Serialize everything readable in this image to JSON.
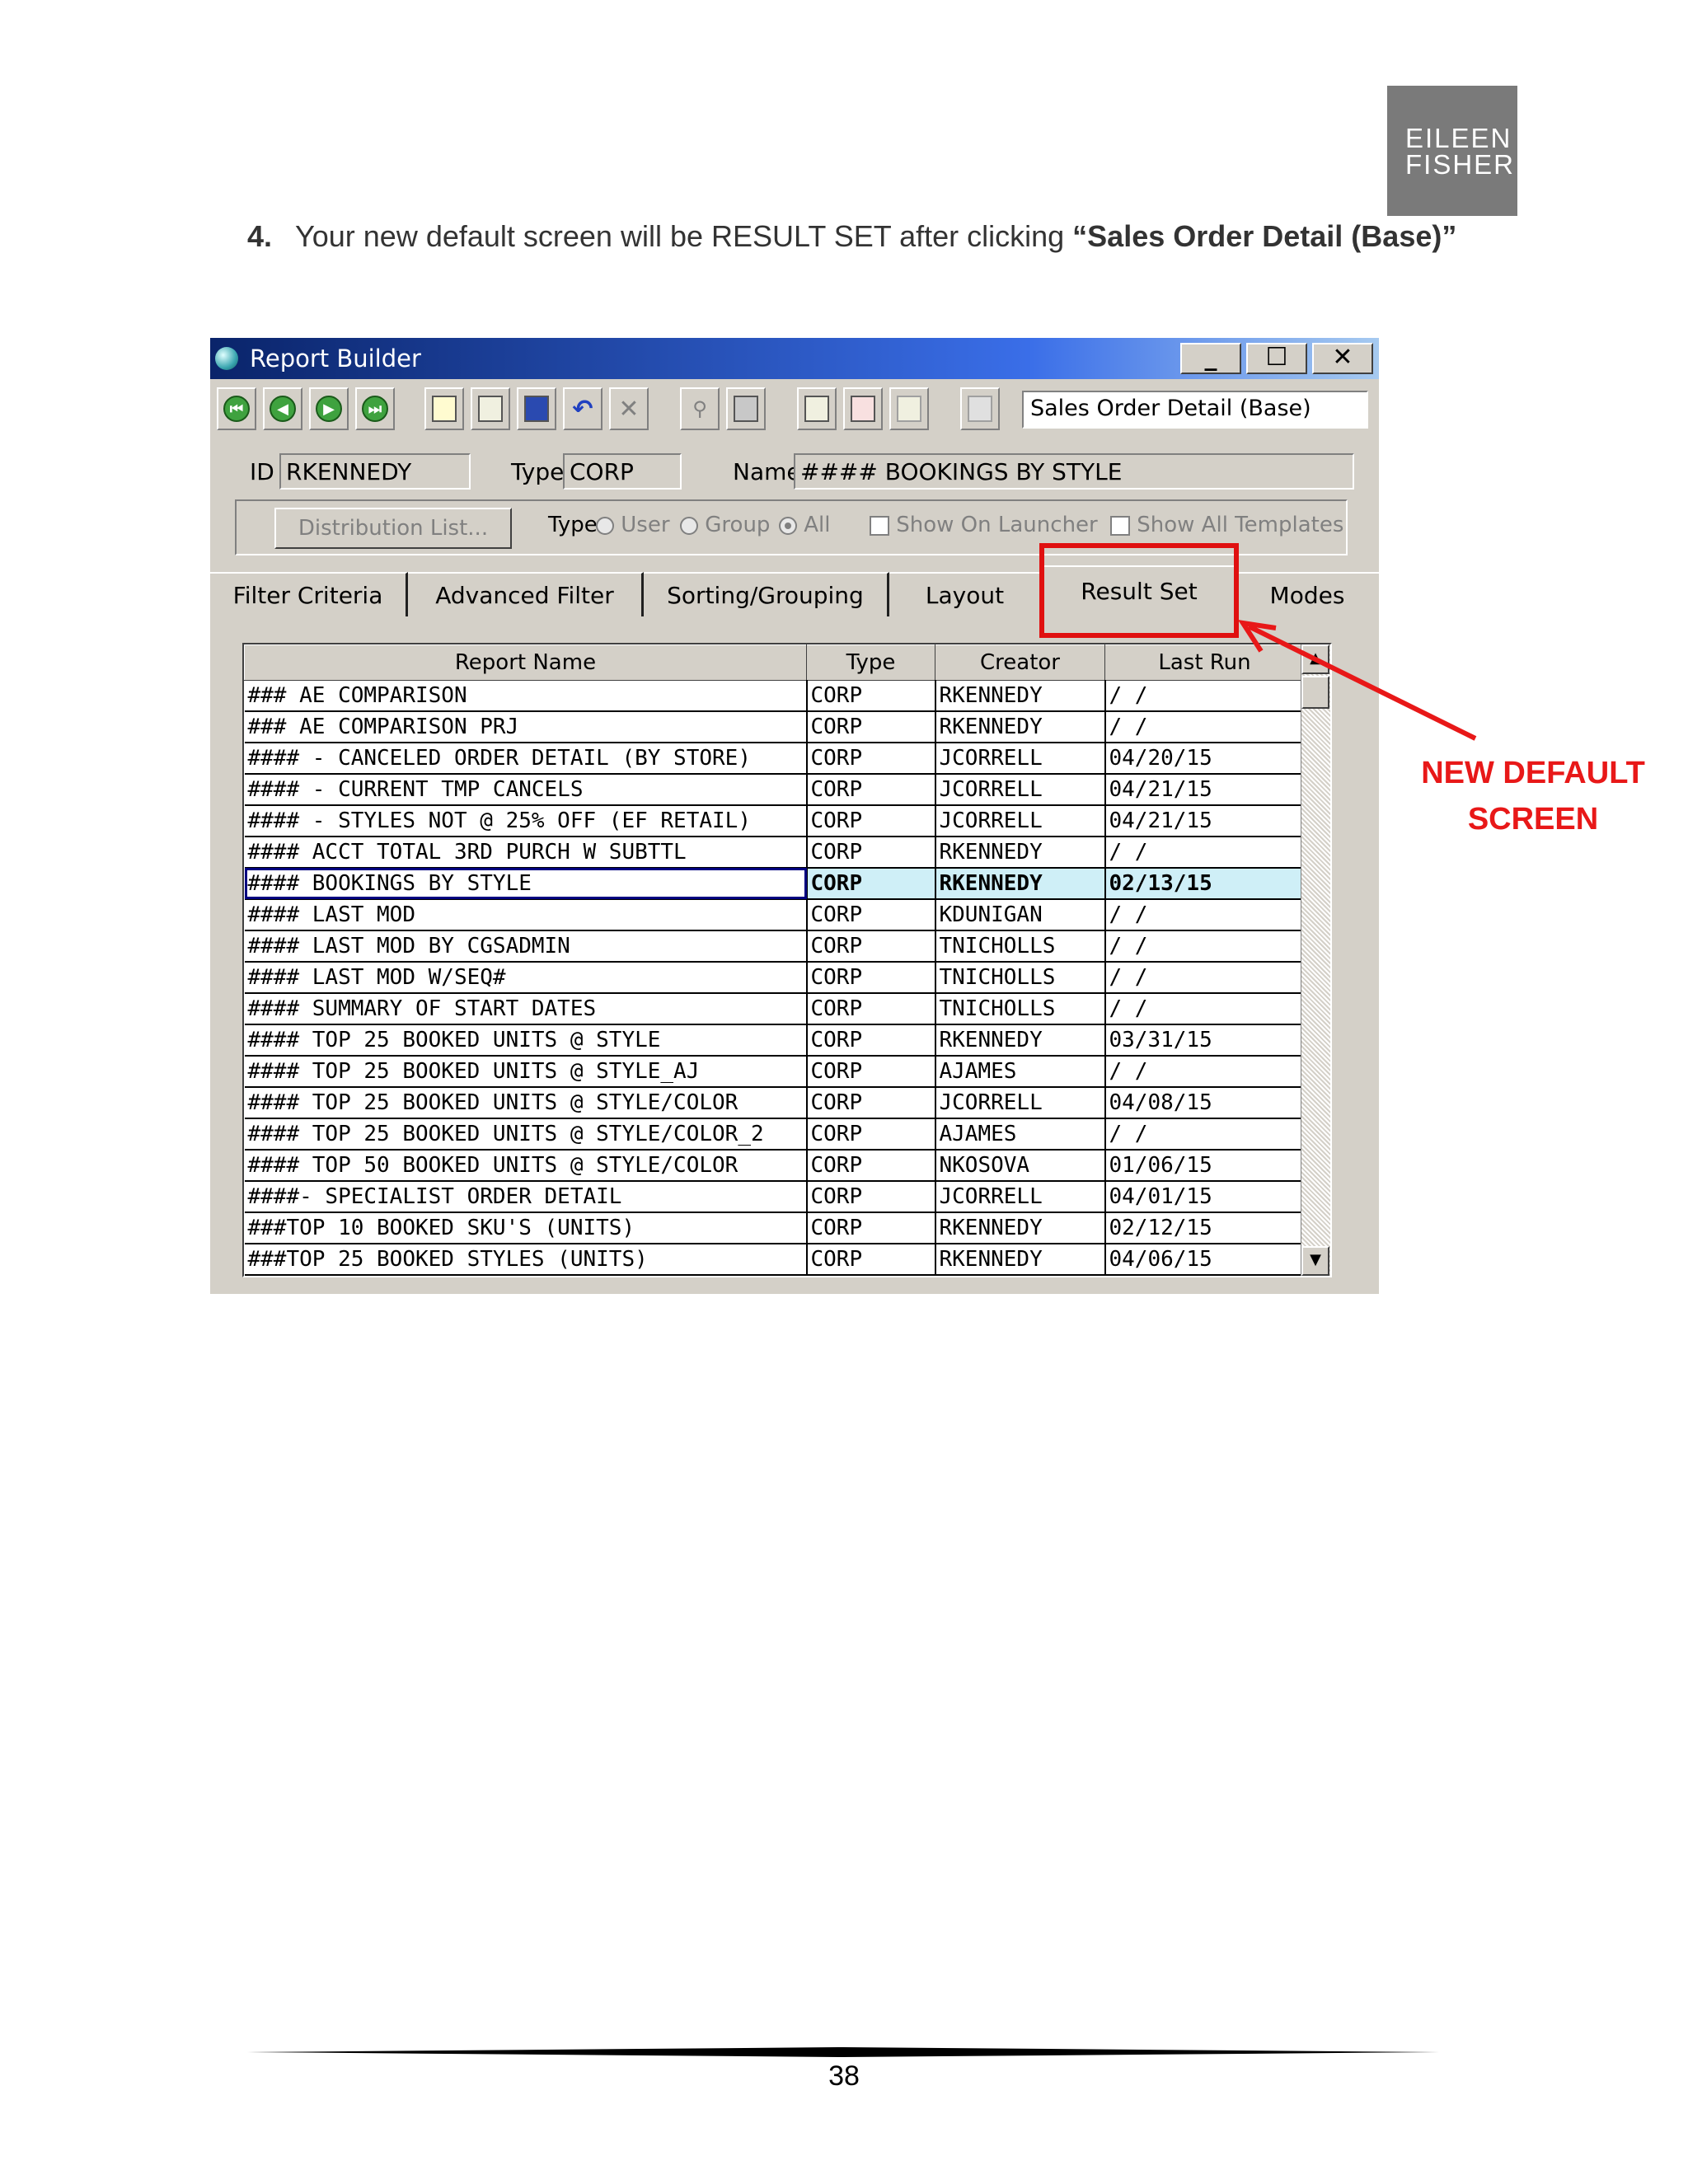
{
  "logo": {
    "line1": "EILEEN",
    "line2": "FISHER"
  },
  "instruction": {
    "number": "4.",
    "text": "Your new default screen will be RESULT SET after clicking ",
    "emphasis": "“Sales Order Detail (Base)”"
  },
  "window": {
    "title": "Report Builder",
    "caption_buttons": {
      "minimize": "_",
      "maximize": "☐",
      "close": "✕"
    },
    "report_select_value": "Sales Order Detail (Base)",
    "id_label": "ID",
    "id_value": "RKENNEDY",
    "type_label": "Type",
    "type_value": "CORP",
    "name_label": "Name",
    "name_value": "#### BOOKINGS BY STYLE",
    "distribution_button": "Distribution List...",
    "type_filter_label": "Type",
    "radio_user": "User",
    "radio_group": "Group",
    "radio_all": "All",
    "radio_selected": "All",
    "show_on_launcher": "Show On Launcher",
    "show_all_templates": "Show All Templates"
  },
  "tabs": [
    {
      "label": "Filter Criteria",
      "active": false
    },
    {
      "label": "Advanced Filter",
      "active": false
    },
    {
      "label": "Sorting/Grouping",
      "active": false
    },
    {
      "label": "Layout",
      "active": false
    },
    {
      "label": "Result Set",
      "active": true
    },
    {
      "label": "Modes",
      "active": false
    }
  ],
  "grid": {
    "columns": [
      "Report Name",
      "Type",
      "Creator",
      "Last Run"
    ],
    "selected_row": 6,
    "rows": [
      [
        "### AE COMPARISON",
        "CORP",
        "RKENNEDY",
        "/ /"
      ],
      [
        "### AE COMPARISON PRJ",
        "CORP",
        "RKENNEDY",
        "/ /"
      ],
      [
        "#### - CANCELED ORDER DETAIL (BY STORE)",
        "CORP",
        "JCORRELL",
        "04/20/15"
      ],
      [
        "#### - CURRENT TMP CANCELS",
        "CORP",
        "JCORRELL",
        "04/21/15"
      ],
      [
        "#### - STYLES NOT @ 25% OFF (EF RETAIL)",
        "CORP",
        "JCORRELL",
        "04/21/15"
      ],
      [
        "#### ACCT TOTAL 3RD PURCH W SUBTTL",
        "CORP",
        "RKENNEDY",
        "/ /"
      ],
      [
        "#### BOOKINGS BY STYLE",
        "CORP",
        "RKENNEDY",
        "02/13/15"
      ],
      [
        "#### LAST MOD",
        "CORP",
        "KDUNIGAN",
        "/ /"
      ],
      [
        "#### LAST MOD BY CGSADMIN",
        "CORP",
        "TNICHOLLS",
        "/ /"
      ],
      [
        "#### LAST MOD W/SEQ#",
        "CORP",
        "TNICHOLLS",
        "/ /"
      ],
      [
        "#### SUMMARY OF START DATES",
        "CORP",
        "TNICHOLLS",
        "/ /"
      ],
      [
        "#### TOP 25  BOOKED UNITS @ STYLE",
        "CORP",
        "RKENNEDY",
        "03/31/15"
      ],
      [
        "#### TOP 25  BOOKED UNITS @ STYLE_AJ",
        "CORP",
        "AJAMES",
        "/ /"
      ],
      [
        "#### TOP 25 BOOKED UNITS @ STYLE/COLOR",
        "CORP",
        "JCORRELL",
        "04/08/15"
      ],
      [
        "#### TOP 25 BOOKED UNITS @ STYLE/COLOR_2",
        "CORP",
        "AJAMES",
        "/ /"
      ],
      [
        "#### TOP 50 BOOKED UNITS @ STYLE/COLOR",
        "CORP",
        "NKOSOVA",
        "01/06/15"
      ],
      [
        "####- SPECIALIST ORDER DETAIL",
        "CORP",
        "JCORRELL",
        "04/01/15"
      ],
      [
        "###TOP 10  BOOKED SKU'S (UNITS)",
        "CORP",
        "RKENNEDY",
        "02/12/15"
      ],
      [
        "###TOP 25  BOOKED STYLES (UNITS)",
        "CORP",
        "RKENNEDY",
        "04/06/15"
      ]
    ]
  },
  "callout": {
    "line1": "NEW DEFAULT",
    "line2": "SCREEN",
    "color": "#e81818"
  },
  "page_number": "38"
}
